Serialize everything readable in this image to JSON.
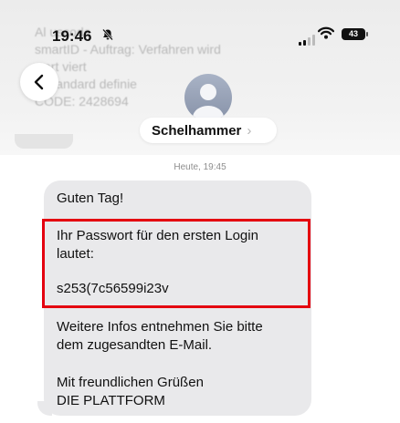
{
  "status_bar": {
    "time": "19:46",
    "battery": "43"
  },
  "background_text": {
    "line1": "Al        uscode",
    "line2": "smartID - Auftrag: Verfahren wird",
    "line3": "ert    viert",
    "line4": "   Standard definie",
    "line5": "CODE: 2428694"
  },
  "contact": {
    "name": "Schelhammer",
    "chevron": "›"
  },
  "message": {
    "timestamp": "Heute, 19:45",
    "greeting": "Guten Tag!",
    "password_line1": "Ihr Passwort für den ersten Login",
    "password_line2": "lautet:",
    "password": "s253(7c56599i23v",
    "info_line1": "Weitere Infos entnehmen Sie bitte",
    "info_line2": "dem zugesandten E-Mail.",
    "closing_line1": "Mit freundlichen Grüßen",
    "closing_line2": "DIE PLATTFORM"
  },
  "icons": {
    "back": "chevron-left-icon",
    "mute": "bell-slash-icon",
    "signal": "cellular-signal-icon",
    "wifi": "wifi-icon",
    "battery": "battery-icon",
    "avatar": "person-icon"
  },
  "colors": {
    "highlight": "#e4000f",
    "bubble": "#e9e9eb"
  }
}
